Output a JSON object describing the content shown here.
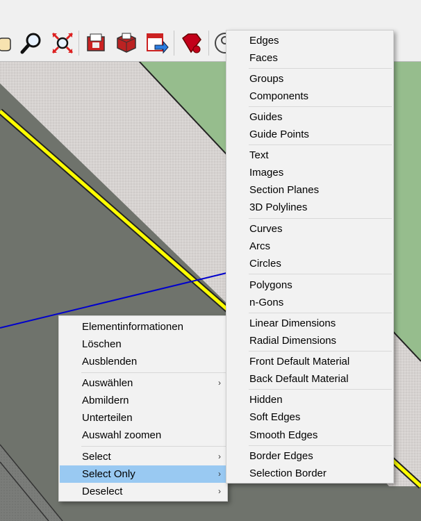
{
  "toolbar": {
    "icons": [
      "pan-icon",
      "zoom-icon",
      "zoom-extents-icon",
      "warehouse-icon",
      "extension-warehouse-icon",
      "send-to-layout-icon",
      "ruby-console-icon",
      "account-icon"
    ]
  },
  "context_menu": {
    "items": [
      {
        "label": "Elementinformationen"
      },
      {
        "label": "Löschen"
      },
      {
        "label": "Ausblenden"
      },
      {
        "label": "Auswählen",
        "submenu": true
      },
      {
        "label": "Abmildern"
      },
      {
        "label": "Unterteilen"
      },
      {
        "label": "Auswahl zoomen"
      },
      {
        "label": "Select",
        "submenu": true
      },
      {
        "label": "Select Only",
        "submenu": true,
        "highlighted": true
      },
      {
        "label": "Deselect",
        "submenu": true
      }
    ]
  },
  "submenu": {
    "items": [
      {
        "label": "Edges"
      },
      {
        "label": "Faces"
      },
      {
        "label": "Groups"
      },
      {
        "label": "Components"
      },
      {
        "label": "Guides"
      },
      {
        "label": "Guide Points"
      },
      {
        "label": "Text"
      },
      {
        "label": "Images"
      },
      {
        "label": "Section Planes"
      },
      {
        "label": "3D Polylines"
      },
      {
        "label": "Curves"
      },
      {
        "label": "Arcs"
      },
      {
        "label": "Circles"
      },
      {
        "label": "Polygons"
      },
      {
        "label": "n-Gons"
      },
      {
        "label": "Linear Dimensions"
      },
      {
        "label": "Radial Dimensions"
      },
      {
        "label": "Front Default Material"
      },
      {
        "label": "Back Default Material"
      },
      {
        "label": "Hidden"
      },
      {
        "label": "Soft Edges"
      },
      {
        "label": "Smooth Edges"
      },
      {
        "label": "Border Edges"
      },
      {
        "label": "Selection Border"
      }
    ]
  },
  "colors": {
    "highlight": "#99c9f2",
    "menu_bg": "#f2f2f2",
    "road": "#d8d4d2",
    "grass": "#96bd8d",
    "ground": "#6f736c",
    "edge_yellow": "#ffff00",
    "axis_blue": "#0000cc"
  }
}
